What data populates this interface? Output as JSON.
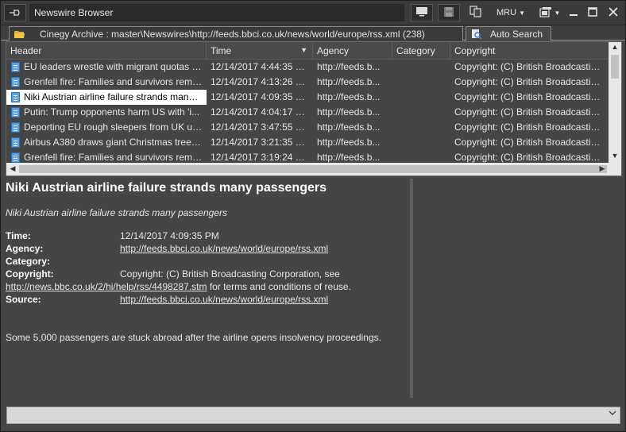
{
  "window": {
    "title": "Newswire Browser",
    "controls": {
      "mru_label": "MRU"
    }
  },
  "tabs": [
    {
      "label": "Cinegy Archive : master\\Newswires\\http://feeds.bbci.co.uk/news/world/europe/rss.xml (238)",
      "icon": "folder-icon"
    },
    {
      "label": "Auto Search",
      "icon": "search-icon"
    }
  ],
  "grid": {
    "columns": [
      "Header",
      "Time",
      "Agency",
      "Category",
      "Copyright"
    ],
    "sorted_column": "Time",
    "rows": [
      {
        "header": "EU leaders wrestle with migrant quotas at...",
        "time": "12/14/2017 4:44:35 PM",
        "agency": "http://feeds.b...",
        "category": "",
        "copyright": "Copyright: (C) British Broadcastin..."
      },
      {
        "header": "Grenfell fire: Families and survivors reme...",
        "time": "12/14/2017 4:13:26 PM",
        "agency": "http://feeds.b...",
        "category": "",
        "copyright": "Copyright: (C) British Broadcastin..."
      },
      {
        "header": "Niki Austrian airline failure strands many ...",
        "time": "12/14/2017 4:09:35 PM",
        "agency": "http://feeds.b...",
        "category": "",
        "copyright": "Copyright: (C) British Broadcastin...",
        "selected": true
      },
      {
        "header": "Putin: Trump opponents harm US with 'i...",
        "time": "12/14/2017 4:04:17 PM",
        "agency": "http://feeds.b...",
        "category": "",
        "copyright": "Copyright: (C) British Broadcastin..."
      },
      {
        "header": "Deporting EU rough sleepers from UK unl...",
        "time": "12/14/2017 3:47:55 PM",
        "agency": "http://feeds.b...",
        "category": "",
        "copyright": "Copyright: (C) British Broadcastin..."
      },
      {
        "header": "Airbus A380 draws giant Christmas tree o...",
        "time": "12/14/2017 3:21:35 PM",
        "agency": "http://feeds.b...",
        "category": "",
        "copyright": "Copyright: (C) British Broadcastin..."
      },
      {
        "header": "Grenfell fire: Families and survivors reme...",
        "time": "12/14/2017 3:19:24 PM",
        "agency": "http://feeds.b...",
        "category": "",
        "copyright": "Copyright: (C) British Broadcastin..."
      }
    ]
  },
  "detail": {
    "title": "Niki Austrian airline failure strands many passengers",
    "summary": "Niki Austrian airline failure strands many passengers",
    "time_label": "Time:",
    "time_value": "12/14/2017 4:09:35 PM",
    "agency_label": "Agency:",
    "agency_value": "http://feeds.bbci.co.uk/news/world/europe/rss.xml",
    "category_label": "Category:",
    "category_value": "",
    "copyright_label": "Copyright:",
    "copyright_value": "Copyright: (C) British Broadcasting Corporation, see",
    "copyright_link": "http://news.bbc.co.uk/2/hi/help/rss/4498287.stm",
    "copyright_tail": " for terms and conditions of reuse.",
    "source_label": "Source:",
    "source_value": "http://feeds.bbci.co.uk/news/world/europe/rss.xml",
    "body": "Some 5,000 passengers are stuck abroad after the airline opens insolvency proceedings."
  },
  "combo": {
    "value": ""
  },
  "colors": {
    "background": "#454545",
    "titlebar": "#3b3b3b",
    "selection": "#ffffff",
    "doc_icon": "#5aa0e8"
  }
}
